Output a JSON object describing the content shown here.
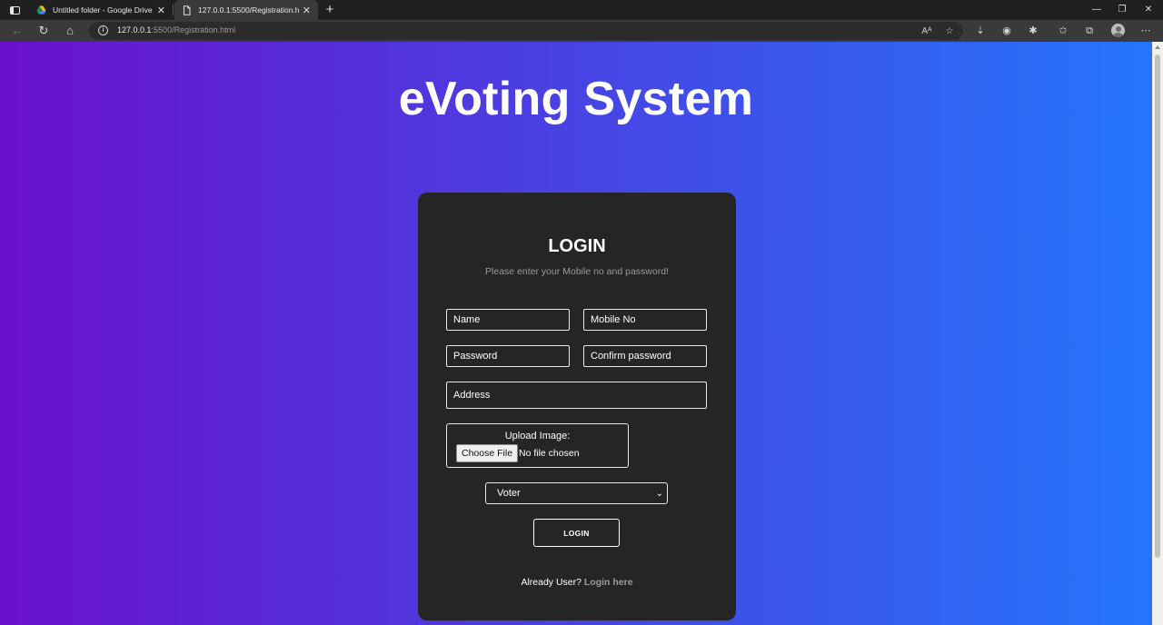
{
  "browser": {
    "tabs": [
      {
        "title": "Untitled folder - Google Drive",
        "favicon": "google-drive-icon"
      },
      {
        "title": "127.0.0.1:5500/Registration.html",
        "favicon": "document-icon"
      }
    ],
    "address": {
      "host": "127.0.0.1",
      "path": ":5500/Registration.html"
    }
  },
  "page": {
    "heading": "eVoting System",
    "card": {
      "title": "LOGIN",
      "subtitle": "Please enter your Mobile no and password!",
      "fields": {
        "name_placeholder": "Name",
        "mobile_placeholder": "Mobile No",
        "password_placeholder": "Password",
        "confirm_placeholder": "Confirm password",
        "address_placeholder": "Address"
      },
      "upload": {
        "label": "Upload Image:",
        "button": "Choose File",
        "status": "No file chosen"
      },
      "role_select": {
        "selected": "Voter"
      },
      "submit_label": "LOGIN",
      "footer": {
        "prompt": "Already User?",
        "link": "Login here"
      }
    }
  },
  "colors": {
    "gradient_start": "#6a11cb",
    "gradient_end": "#2575fc",
    "card_bg": "#252525"
  }
}
